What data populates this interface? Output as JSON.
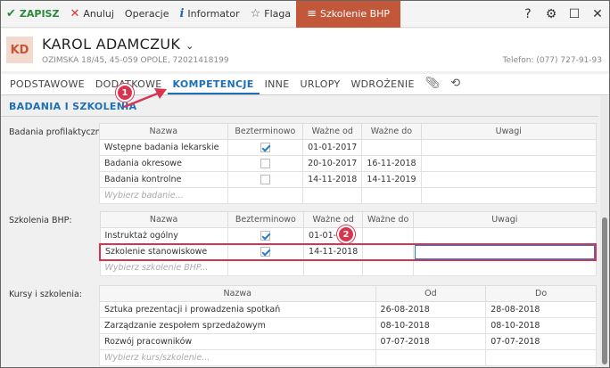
{
  "toolbar": {
    "save": "ZAPISZ",
    "cancel": "Anuluj",
    "operations": "Operacje",
    "informator": "Informator",
    "flag": "Flaga",
    "bhp": "Szkolenie BHP",
    "help": "?"
  },
  "person": {
    "initials": "KD",
    "name": "KAROL ADAMCZUK",
    "address": "OZIMSKA 18/45, 45-059 OPOLE, 72021418199",
    "phone": "Telefon: (077) 727-91-93"
  },
  "tabs": [
    "PODSTAWOWE",
    "DODATKOWE",
    "KOMPETENCJE",
    "INNE",
    "URLOPY",
    "WDROŻENIE"
  ],
  "section_title": "BADANIA I SZKOLENIA",
  "badania": {
    "label": "Badania profilaktyczne:",
    "headers": [
      "Nazwa",
      "Bezterminowo",
      "Ważne od",
      "Ważne do",
      "Uwagi"
    ],
    "rows": [
      {
        "name": "Wstępne badania lekarskie",
        "indefinite": true,
        "from": "01-01-2017",
        "to": "",
        "notes": ""
      },
      {
        "name": "Badania okresowe",
        "indefinite": false,
        "from": "20-10-2017",
        "to": "16-11-2018",
        "notes": ""
      },
      {
        "name": "Badania kontrolne",
        "indefinite": false,
        "from": "14-11-2018",
        "to": "14-11-2019",
        "notes": ""
      }
    ],
    "placeholder": "Wybierz badanie..."
  },
  "bhp": {
    "label": "Szkolenia BHP:",
    "headers": [
      "Nazwa",
      "Bezterminowo",
      "Ważne od",
      "Ważne do",
      "Uwagi"
    ],
    "rows": [
      {
        "name": "Instruktaż ogólny",
        "indefinite": true,
        "from": "01-01-2",
        "to": "",
        "notes": ""
      },
      {
        "name": "Szkolenie stanowiskowe",
        "indefinite": true,
        "from": "14-11-2018",
        "to": "",
        "notes": ""
      }
    ],
    "placeholder": "Wybierz szkolenie BHP..."
  },
  "kursy": {
    "label": "Kursy i szkolenia:",
    "headers": [
      "Nazwa",
      "Od",
      "Do"
    ],
    "rows": [
      {
        "name": "Sztuka prezentacji i prowadzenia spotkań",
        "from": "26-08-2018",
        "to": "28-08-2018"
      },
      {
        "name": "Zarządzanie zespołem sprzedażowym",
        "from": "08-10-2018",
        "to": "08-10-2018"
      },
      {
        "name": "Rozwój pracowników",
        "from": "07-07-2018",
        "to": "07-07-2018"
      }
    ],
    "placeholder": "Wybierz kurs/szkolenie..."
  },
  "annotations": {
    "badge1": "1",
    "badge2": "2"
  },
  "colors": {
    "accent": "#1e6fb5",
    "bhp_tab": "#c2573a",
    "highlight": "#d9344f",
    "save": "#2a8a3a"
  }
}
